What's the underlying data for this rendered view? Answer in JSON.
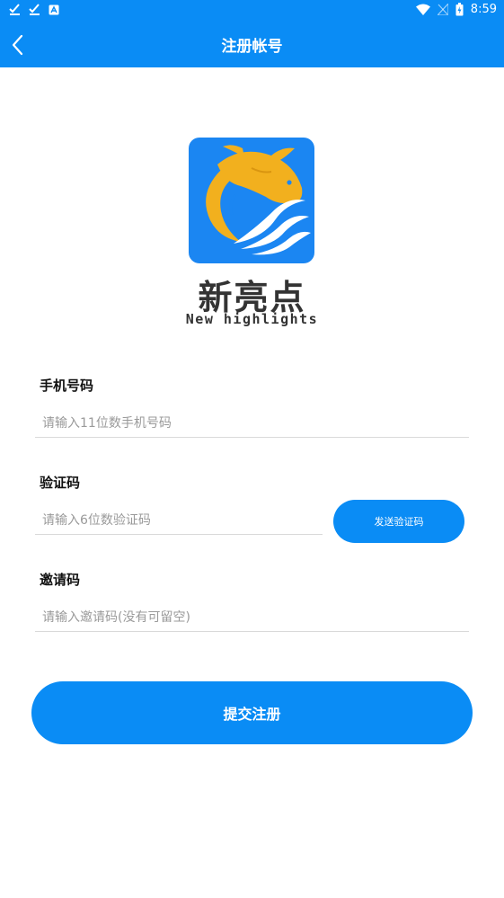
{
  "status_bar": {
    "time": "8:59",
    "left_icons": [
      "check-download-icon",
      "check-download-icon",
      "app-notification-icon"
    ],
    "right_icons": [
      "wifi-icon",
      "no-signal-icon",
      "battery-icon"
    ]
  },
  "header": {
    "title": "注册帐号",
    "back_icon": "chevron-left-icon"
  },
  "brand": {
    "name_cn": "新亮点",
    "name_en": "New highlights"
  },
  "form": {
    "phone": {
      "label": "手机号码",
      "placeholder": "请输入11位数手机号码",
      "value": ""
    },
    "code": {
      "label": "验证码",
      "placeholder": "请输入6位数验证码",
      "value": "",
      "send_button": "发送验证码"
    },
    "invite": {
      "label": "邀请码",
      "placeholder": "请输入邀请码(没有可留空)",
      "value": ""
    },
    "submit_label": "提交注册"
  },
  "colors": {
    "primary": "#0a8cf5",
    "logo_bg": "#1b86f2",
    "fish": "#f2b01e",
    "text_dark": "#333333",
    "placeholder": "#9a9a9a"
  }
}
